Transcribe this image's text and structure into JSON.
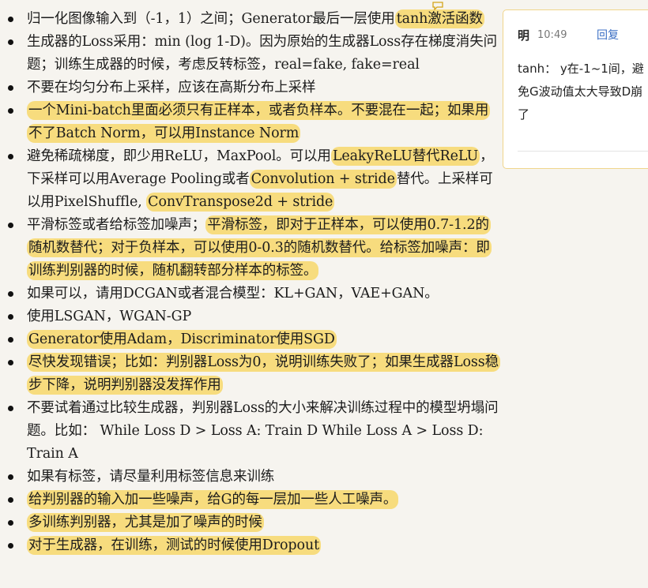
{
  "notes": [
    {
      "segments": [
        {
          "t": "归一化图像输入到（-1，1）之间；Generator最后一层使用",
          "hl": false
        },
        {
          "t": "tanh激活函数",
          "hl": true
        }
      ]
    },
    {
      "segments": [
        {
          "t": "生成器的Loss采用：min (log 1-D)。因为原始的生成器Loss存在梯度消失问题；训练生成器的时候，考虑反转标签，real=fake, fake=real",
          "hl": false
        }
      ]
    },
    {
      "segments": [
        {
          "t": "不要在均匀分布上采样，应该在高斯分布上采样",
          "hl": false
        }
      ]
    },
    {
      "segments": [
        {
          "t": "一个Mini-batch里面必须只有正样本，或者负样本。不要混在一起；如果用不了Batch Norm，可以用Instance Norm",
          "hl": true
        }
      ]
    },
    {
      "segments": [
        {
          "t": "避免稀疏梯度，即少用ReLU，MaxPool。可以用",
          "hl": false
        },
        {
          "t": "LeakyReLU替代ReLU",
          "hl": true
        },
        {
          "t": "，下采样可以用Average Pooling或者",
          "hl": false
        },
        {
          "t": "Convolution + stride",
          "hl": true
        },
        {
          "t": "替代。上采样可以用PixelShuffle, ",
          "hl": false
        },
        {
          "t": "ConvTranspose2d + stride",
          "hl": true
        }
      ]
    },
    {
      "segments": [
        {
          "t": "平滑标签或者给标签加噪声；",
          "hl": false
        },
        {
          "t": "平滑标签，即对于正样本，可以使用0.7-1.2的随机数替代；对于负样本，可以使用0-0.3的随机数替代。给标签加噪声：即训练判别器的时候，随机翻转部分样本的标签。",
          "hl": true
        }
      ]
    },
    {
      "segments": [
        {
          "t": "如果可以，请用DCGAN或者混合模型：KL+GAN，VAE+GAN。",
          "hl": false
        }
      ]
    },
    {
      "segments": [
        {
          "t": "使用LSGAN，WGAN-GP",
          "hl": false
        }
      ]
    },
    {
      "segments": [
        {
          "t": "Generator使用Adam，Discriminator使用SGD",
          "hl": true
        }
      ]
    },
    {
      "segments": [
        {
          "t": "尽快发现错误；比如：判别器Loss为0，说明训练失败了；如果生成器Loss稳步下降，说明判别器没发挥作用",
          "hl": true
        }
      ]
    },
    {
      "segments": [
        {
          "t": "不要试着通过比较生成器，判别器Loss的大小来解决训练过程中的模型坍塌问题。比如： While Loss D > Loss A: Train D While Loss A > Loss D: Train A",
          "hl": false
        }
      ]
    },
    {
      "segments": [
        {
          "t": "如果有标签，请尽量利用标签信息来训练",
          "hl": false
        }
      ]
    },
    {
      "segments": [
        {
          "t": "给判别器的输入加一些噪声，给G的每一层加一些人工噪声。",
          "hl": true
        }
      ]
    },
    {
      "segments": [
        {
          "t": "多训练判别器，尤其是加了噪声的时候",
          "hl": true
        }
      ]
    },
    {
      "segments": [
        {
          "t": "对于生成器，在训练，测试的时候使用Dropout",
          "hl": true
        }
      ]
    }
  ],
  "comment": {
    "author": "明",
    "time": "10:49",
    "reply_label": "回复",
    "body": "tanh： y在-1~1间，避免G波动值太大导致D崩了",
    "marker_icon": "comment-marker-icon",
    "more_icon": "more-icon"
  },
  "colors": {
    "highlight": "#f7dc7e",
    "background": "#f6f4ef",
    "reply_link": "#3b6fc4"
  }
}
